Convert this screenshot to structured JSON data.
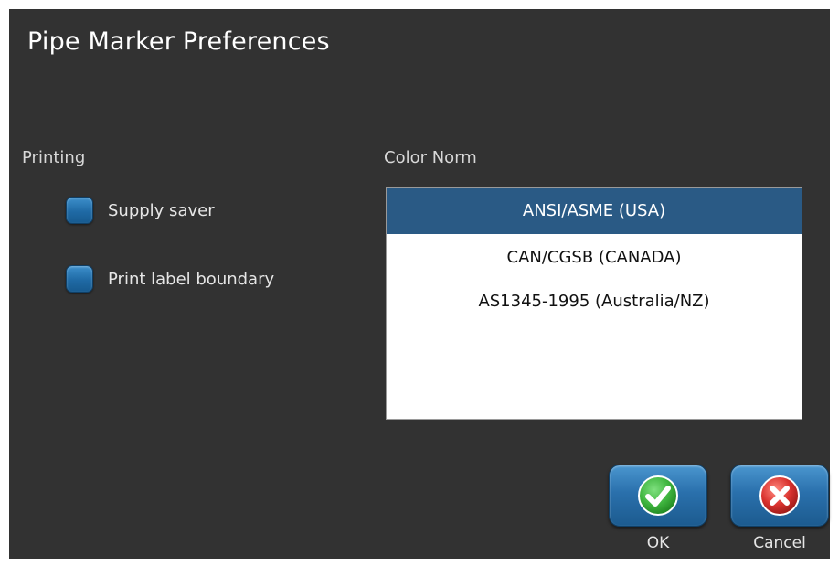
{
  "dialog": {
    "title": "Pipe Marker Preferences"
  },
  "printing": {
    "label": "Printing",
    "options": [
      {
        "label": "Supply saver",
        "checked": false
      },
      {
        "label": "Print label boundary",
        "checked": false
      }
    ]
  },
  "color_norm": {
    "label": "Color Norm",
    "items": [
      {
        "label": "ANSI/ASME (USA)",
        "selected": true
      },
      {
        "label": "CAN/CGSB (CANADA)",
        "selected": false
      },
      {
        "label": "AS1345-1995 (Australia/NZ)",
        "selected": false
      }
    ]
  },
  "buttons": {
    "ok_label": "OK",
    "ok_icon": "check-circle-icon",
    "cancel_label": "Cancel",
    "cancel_icon": "x-circle-icon"
  },
  "colors": {
    "background": "#323232",
    "selection": "#2a5a85",
    "button_blue": "#2a70ac",
    "ok_green": "#3fb53f",
    "cancel_red": "#d9322e"
  }
}
